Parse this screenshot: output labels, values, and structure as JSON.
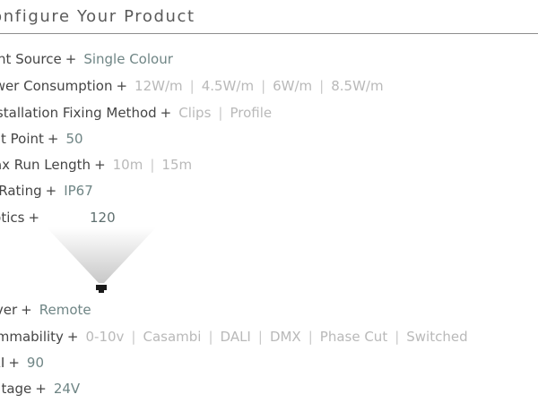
{
  "page": {
    "title": "Configure Your Product"
  },
  "options": [
    {
      "id": "light-source",
      "label": "Light Source",
      "values": [
        "Single Colour"
      ],
      "selected": 0
    },
    {
      "id": "power-consumption",
      "label": "Power Consumption",
      "values": [
        "12W/m",
        "4.5W/m",
        "6W/m",
        "8.5W/m"
      ],
      "selected": null
    },
    {
      "id": "fixing-method",
      "label": "Installation Fixing Method",
      "values": [
        "Clips",
        "Profile"
      ],
      "selected": null
    },
    {
      "id": "cut-point",
      "label": "Cut Point",
      "values": [
        "50"
      ],
      "selected": 0
    },
    {
      "id": "max-run-length",
      "label": "Max Run Length",
      "values": [
        "10m",
        "15m"
      ],
      "selected": null
    },
    {
      "id": "ip-rating",
      "label": "IP Rating",
      "values": [
        "IP67"
      ],
      "selected": 0
    },
    {
      "id": "optics",
      "label": "Optics",
      "values": [
        "120"
      ],
      "selected": 0
    },
    {
      "id": "driver",
      "label": "Driver",
      "values": [
        "Remote"
      ],
      "selected": 0
    },
    {
      "id": "dimmability",
      "label": "Dimmability",
      "values": [
        "0-10v",
        "Casambi",
        "DALI",
        "DMX",
        "Phase Cut",
        "Switched"
      ],
      "selected": null
    },
    {
      "id": "cri",
      "label": "CRI",
      "values": [
        "90"
      ],
      "selected": 0
    },
    {
      "id": "voltage",
      "label": "Voltage",
      "values": [
        "24V"
      ],
      "selected": 0
    }
  ],
  "plus_symbol": "+",
  "icons": {
    "beam": "beam-angle-120-icon"
  }
}
